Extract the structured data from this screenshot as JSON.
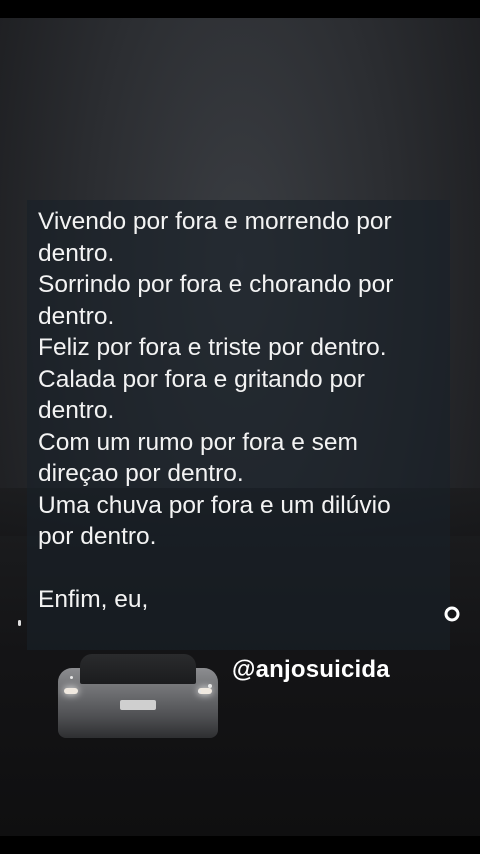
{
  "poem": {
    "lines": [
      "Vivendo por fora e morrendo por",
      "dentro.",
      "Sorrindo por fora e chorando por",
      "dentro.",
      "Feliz por fora e triste por dentro.",
      "Calada por fora e gritando por",
      "dentro.",
      "Com um rumo por fora e sem",
      "direçao por dentro.",
      "Uma chuva por fora e um dilúvio",
      "por dentro."
    ],
    "closing": "Enfim, eu,"
  },
  "watermark": {
    "handle": "@anjosuicida"
  },
  "icons": {
    "loop": "loop-icon"
  },
  "colors": {
    "background": "#000000",
    "text": "#f3f3f3",
    "card": "#182028"
  }
}
